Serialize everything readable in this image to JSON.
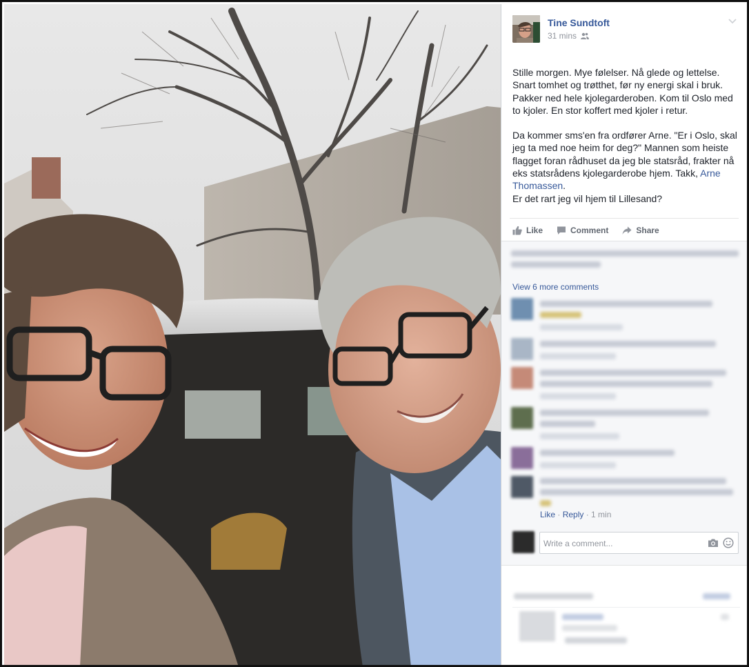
{
  "post": {
    "author": "Tine Sundtoft",
    "time": "31 mins",
    "audience_icon": "friends-icon",
    "paragraph1": "Stille morgen. Mye følelser. Nå glede og lettelse. Snart tomhet og trøtthet, før ny energi skal i bruk. Pakker ned hele kjolegarderoben. Kom til Oslo med to kjoler. En stor koffert med kjoler i retur.",
    "paragraph2_text": "Da kommer sms'en fra ordfører Arne. \"Er i Oslo, skal jeg ta med noe heim for deg?\" Mannen som heiste flagget foran rådhuset da jeg ble statsråd, frakter nå eks statsrådens kjolegarderobe hjem. Takk, ",
    "paragraph2_link": "Arne Thomassen",
    "paragraph2_end": ".",
    "paragraph3": "Er det rart jeg vil hjem til Lillesand?"
  },
  "actions": {
    "like": "Like",
    "comment": "Comment",
    "share": "Share"
  },
  "comments": {
    "view_more": "View 6 more comments",
    "last_reply": {
      "like": "Like",
      "sep1": " · ",
      "reply": "Reply",
      "sep2": " · ",
      "time": "1 min"
    }
  },
  "composer": {
    "placeholder": "Write a comment..."
  },
  "colors": {
    "link": "#365899",
    "muted": "#90949c",
    "action": "#616770"
  }
}
